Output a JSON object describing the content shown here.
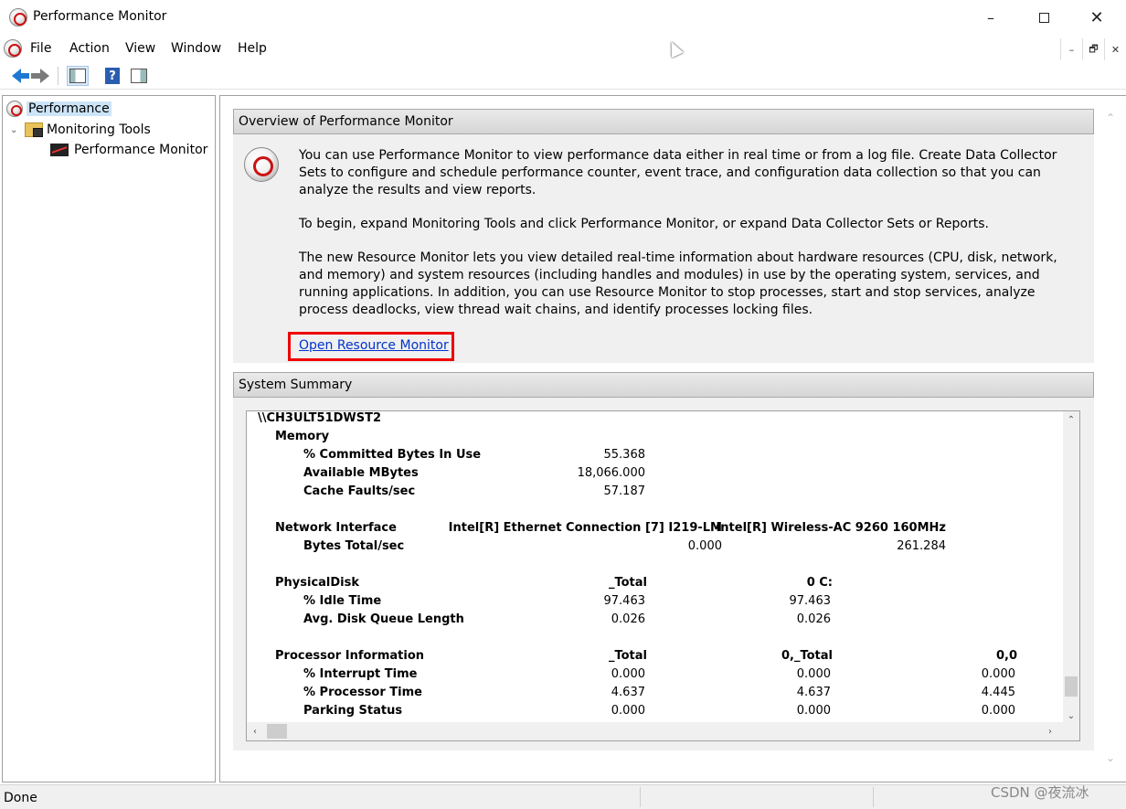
{
  "window": {
    "title": "Performance Monitor",
    "min_glyph": "–",
    "close_glyph": "✕"
  },
  "menu": {
    "items": [
      "File",
      "Action",
      "View",
      "Window",
      "Help"
    ]
  },
  "mdi_buttons": [
    "–",
    "🗗",
    "✕"
  ],
  "toolbar": {
    "help_glyph": "?"
  },
  "tree": {
    "root": "Performance",
    "expander": "⌄",
    "monitoring_tools": "Monitoring Tools",
    "performance_monitor": "Performance Monitor"
  },
  "overview": {
    "header": "Overview of Performance Monitor",
    "para1": "You can use Performance Monitor to view performance data either in real time or from a log file. Create Data Collector Sets to configure and schedule performance counter, event trace, and configuration data collection so that you can analyze the results and view reports.",
    "para2": "To begin, expand Monitoring Tools and click Performance Monitor, or expand Data Collector Sets or Reports.",
    "para3": "The new Resource Monitor lets you view detailed real-time information about hardware resources (CPU, disk, network, and memory) and system resources (including handles and modules) in use by the operating system, services, and running applications. In addition, you can use Resource Monitor to stop processes, start and stop services, analyze process deadlocks, view thread wait chains, and identify processes locking files.",
    "link": "Open Resource Monitor"
  },
  "summary": {
    "header": "System Summary",
    "machine": "\\\\CH3ULT51DWST2",
    "memory": {
      "label": "Memory",
      "committed_label": "% Committed Bytes In Use",
      "committed": "55.368",
      "available_label": "Available MBytes",
      "available": "18,066.000",
      "cache_label": "Cache Faults/sec",
      "cache": "57.187"
    },
    "network": {
      "label": "Network Interface",
      "adapter1": "Intel[R] Ethernet Connection [7] I219-LM",
      "adapter2": "Intel[R] Wireless-AC 9260 160MHz",
      "bytes_label": "Bytes Total/sec",
      "bytes1": "0.000",
      "bytes2": "261.284"
    },
    "disk": {
      "label": "PhysicalDisk",
      "col1": "_Total",
      "col2": "0 C:",
      "idle_label": "% Idle Time",
      "idle1": "97.463",
      "idle2": "97.463",
      "queue_label": "Avg. Disk Queue Length",
      "queue1": "0.026",
      "queue2": "0.026"
    },
    "processor": {
      "label": "Processor Information",
      "col1": "_Total",
      "col2": "0,_Total",
      "col3": "0,0",
      "interrupt_label": "% Interrupt Time",
      "interrupt1": "0.000",
      "interrupt2": "0.000",
      "interrupt3": "0.000",
      "proc_label": "% Processor Time",
      "proc1": "4.637",
      "proc2": "4.637",
      "proc3": "4.445",
      "parking_label": "Parking Status",
      "parking1": "0.000",
      "parking2": "0.000",
      "parking3": "0.000"
    }
  },
  "scroll_glyphs": {
    "up": "⌃",
    "down": "⌄",
    "left": "‹",
    "right": "›"
  },
  "status": {
    "text": "Done"
  },
  "watermark": "CSDN @夜流冰"
}
